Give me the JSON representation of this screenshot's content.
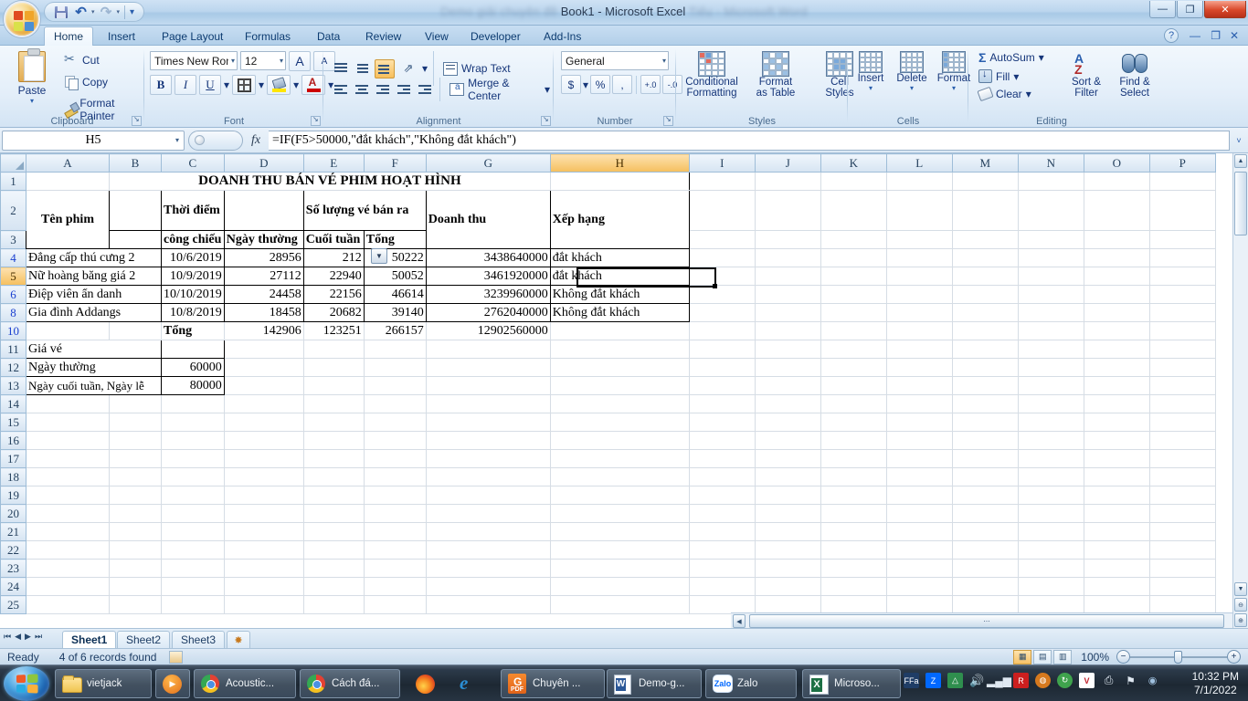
{
  "window": {
    "title_visible": "Book1 - Microsoft Excel",
    "title_blur_left": "Demo giải chuyên đề",
    "title_blur_right": "Tiếu - Microsoft Word",
    "minimize": "—",
    "maximize": "❐",
    "close": "✕"
  },
  "quick_access": {
    "save": "save-icon",
    "undo": "↺",
    "redo": "↻",
    "customize": "▾"
  },
  "ribbon": {
    "tabs": [
      {
        "label": "Home",
        "active": true
      },
      {
        "label": "Insert",
        "active": false
      },
      {
        "label": "Page Layout",
        "active": false
      },
      {
        "label": "Formulas",
        "active": false
      },
      {
        "label": "Data",
        "active": false
      },
      {
        "label": "Review",
        "active": false
      },
      {
        "label": "View",
        "active": false
      },
      {
        "label": "Developer",
        "active": false
      },
      {
        "label": "Add-Ins",
        "active": false
      }
    ],
    "help_label": "?",
    "minimize_ribbon": "—",
    "restore_ribbon": "❐",
    "close_window_small": "✕",
    "groups": {
      "clipboard": {
        "label": "Clipboard",
        "paste": "Paste",
        "paste_caret": "▾",
        "cut": "Cut",
        "copy": "Copy",
        "format_painter": "Format Painter"
      },
      "font": {
        "label": "Font",
        "font_name": "Times New Rom",
        "font_size": "12",
        "grow": "A",
        "shrink": "A",
        "bold": "B",
        "italic": "I",
        "underline": "U",
        "caret": "▾"
      },
      "alignment": {
        "label": "Alignment",
        "wrap_text": "Wrap Text",
        "merge_center": "Merge & Center",
        "merge_caret": "▾",
        "orientation_caret": "▾"
      },
      "number": {
        "label": "Number",
        "format": "General",
        "currency": "$",
        "percent": "%",
        "comma": ",",
        "increase_decimal": "+.0",
        "decrease_decimal": "-.0",
        "caret": "▾"
      },
      "styles": {
        "label": "Styles",
        "conditional_formatting": "Conditional\nFormatting",
        "conditional_formatting_l1": "Conditional",
        "conditional_formatting_l2": "Formatting",
        "format_as_table_l1": "Format",
        "format_as_table_l2": "as Table",
        "cell_styles_l1": "Cell",
        "cell_styles_l2": "Styles",
        "caret": "▾"
      },
      "cells": {
        "label": "Cells",
        "insert": "Insert",
        "delete": "Delete",
        "format": "Format",
        "caret": "▾"
      },
      "editing": {
        "label": "Editing",
        "autosum": "AutoSum",
        "fill": "Fill",
        "clear": "Clear",
        "sort_filter_l1": "Sort &",
        "sort_filter_l2": "Filter",
        "find_select_l1": "Find &",
        "find_select_l2": "Select",
        "sigma": "Σ",
        "caret": "▾"
      }
    }
  },
  "formula_bar": {
    "name_box": "H5",
    "name_box_caret": "▾",
    "fx": "fx",
    "formula": "=IF(F5>50000,\"đắt khách\",\"Không đắt khách\")",
    "expand_caret": "˅"
  },
  "grid": {
    "column_headers": [
      "A",
      "B",
      "C",
      "D",
      "E",
      "F",
      "G",
      "H",
      "I",
      "J",
      "K",
      "L",
      "M",
      "N",
      "O",
      "P"
    ],
    "selected_column": "H",
    "selected_row": "5",
    "filtered_rows": [
      "4",
      "5",
      "6",
      "8",
      "10"
    ],
    "row_numbers": [
      "1",
      "2",
      "3",
      "4",
      "5",
      "6",
      "8",
      "10",
      "11",
      "12",
      "13",
      "14",
      "15",
      "16",
      "17",
      "18",
      "19",
      "20",
      "21",
      "22",
      "23",
      "24",
      "25"
    ],
    "title_cell": "DOANH THU BÁN VÉ PHIM HOẠT HÌNH",
    "headers": {
      "ten_phim": "Tên phim",
      "thoi_diem": "Thời điểm",
      "cong_chieu": "công chiếu",
      "so_luong": "Số lượng vé bán ra",
      "ngay_thuong": "Ngày thường",
      "cuoi_tuan": "Cuối tuần",
      "tong": "Tổng",
      "doanh_thu": "Doanh thu",
      "xep_hang": "Xếp hạng"
    },
    "rows": [
      {
        "row": "4",
        "name": "Đẳng cấp thú cưng 2",
        "date": "10/6/2019",
        "weekday": "28956",
        "weekend": "212",
        "total": "50222",
        "revenue": "3438640000",
        "rank": "đắt khách"
      },
      {
        "row": "5",
        "name": "Nữ hoàng băng giá 2",
        "date": "10/9/2019",
        "weekday": "27112",
        "weekend": "22940",
        "total": "50052",
        "revenue": "3461920000",
        "rank": "đắt khách"
      },
      {
        "row": "6",
        "name": "Điệp viên ẩn danh",
        "date": "10/10/2019",
        "weekday": "24458",
        "weekend": "22156",
        "total": "46614",
        "revenue": "3239960000",
        "rank": "Không đắt khách"
      },
      {
        "row": "8",
        "name": "Gia đình Addangs",
        "date": "10/8/2019",
        "weekday": "18458",
        "weekend": "20682",
        "total": "39140",
        "revenue": "2762040000",
        "rank": "Không đắt khách"
      }
    ],
    "totals": {
      "label": "Tổng",
      "weekday": "142906",
      "weekend": "123251",
      "total": "266157",
      "revenue": "12902560000"
    },
    "price_block": {
      "title": "Giá vé",
      "weekday_label": "Ngày thường",
      "weekday_value": "60000",
      "weekend_label": "Ngày cuối tuần, Ngày lễ",
      "weekend_value": "80000"
    },
    "filter_button": "filter-dropdown-icon"
  },
  "sheet_tabs": {
    "first": "⏮",
    "prev": "◀",
    "next": "▶",
    "last": "⏭",
    "tabs": [
      {
        "label": "Sheet1",
        "active": true
      },
      {
        "label": "Sheet2",
        "active": false
      },
      {
        "label": "Sheet3",
        "active": false
      }
    ],
    "insert_sheet": "insert-sheet-icon"
  },
  "status_bar": {
    "state": "Ready",
    "records": "4 of 6 records found",
    "view_normal": "▦",
    "view_page_layout": "▤",
    "view_page_break": "▥",
    "zoom": "100%",
    "zoom_out": "−",
    "zoom_in": "+"
  },
  "taskbar": {
    "start": "start-orb",
    "items": [
      {
        "icon": "folder-icon",
        "label": "vietjack"
      },
      {
        "icon": "media-player-icon",
        "label": ""
      },
      {
        "icon": "chrome-icon",
        "label": "Acoustic..."
      },
      {
        "icon": "chrome-icon",
        "label": "Cách đá..."
      },
      {
        "icon": "firefox-icon",
        "label": ""
      },
      {
        "icon": "internet-explorer-icon",
        "label": ""
      },
      {
        "icon": "pdf-icon",
        "label": "Chuyên ..."
      },
      {
        "icon": "word-icon",
        "label": "Demo-g..."
      },
      {
        "icon": "zalo-icon",
        "label": "Zalo"
      },
      {
        "icon": "excel-icon",
        "label": "Microso..."
      }
    ],
    "tray": [
      "font-icon",
      "zalo-tray-icon",
      "google-drive-icon",
      "volume-icon",
      "network-icon",
      "antivirus-icon",
      "unikey-icon",
      "sync-icon",
      "v-icon",
      "printer-icon",
      "flag-icon",
      "arrow-icon"
    ],
    "time": "10:32 PM",
    "date": "7/1/2022"
  }
}
